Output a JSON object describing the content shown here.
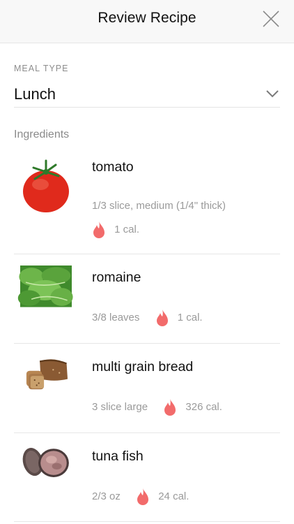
{
  "header": {
    "title": "Review Recipe",
    "close_icon": "close-icon"
  },
  "meal": {
    "label": "MEAL TYPE",
    "value": "Lunch",
    "chevron_icon": "chevron-down-icon"
  },
  "ingredients": {
    "label": "Ingredients",
    "items": [
      {
        "name": "tomato",
        "amount": "1/3 slice, medium (1/4\" thick)",
        "calories": "1 cal.",
        "image_icon": "tomato-image"
      },
      {
        "name": "romaine",
        "amount": "3/8 leaves",
        "calories": "1 cal.",
        "image_icon": "romaine-image"
      },
      {
        "name": "multi grain bread",
        "amount": "3 slice large",
        "calories": "326 cal.",
        "image_icon": "bread-image"
      },
      {
        "name": "tuna fish",
        "amount": "2/3 oz",
        "calories": "24 cal.",
        "image_icon": "tuna-can-image"
      }
    ]
  },
  "colors": {
    "flame": "#f26b6b",
    "accent_text": "#111111",
    "muted_text": "#9a9a9a"
  }
}
